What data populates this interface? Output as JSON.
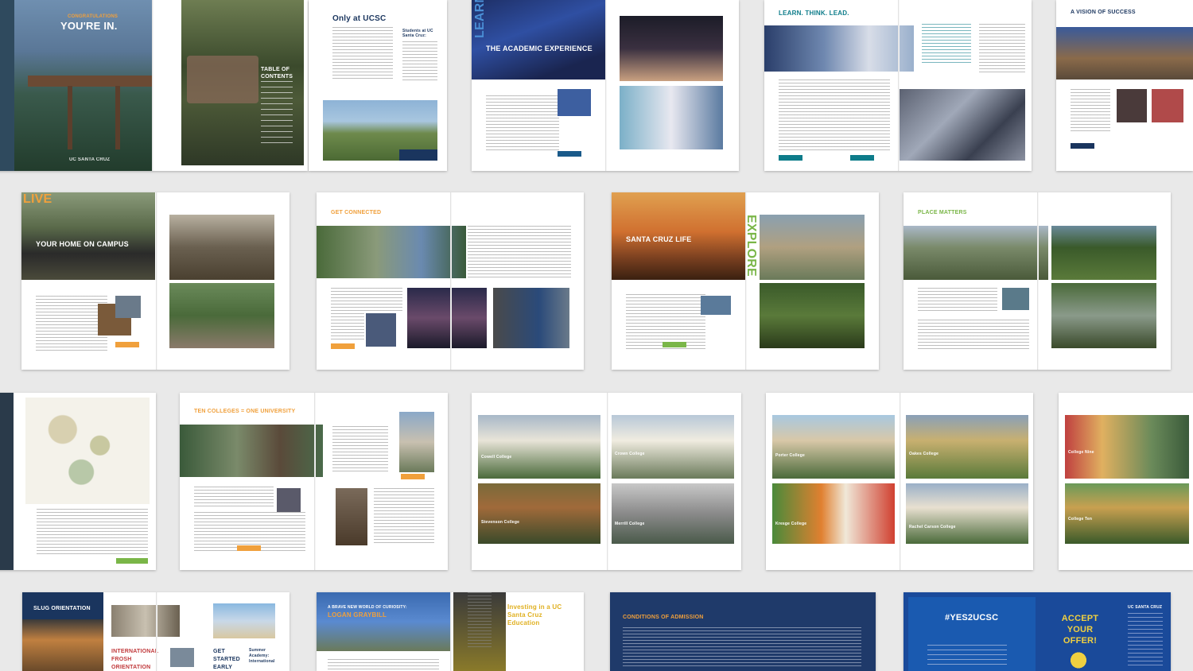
{
  "spreads": {
    "youre_in": {
      "kicker": "CONGRATULATIONS",
      "title": "YOU'RE IN.",
      "logo": "UC SANTA CRUZ",
      "toc_title": "TABLE OF CONTENTS"
    },
    "only_ucsc": {
      "title": "Only at UCSC",
      "sidebar_title": "Students at UC Santa Cruz:"
    },
    "academic": {
      "vertical": "LEARN",
      "title": "THE ACADEMIC EXPERIENCE"
    },
    "learn_think": {
      "title": "LEARN. THINK. LEAD."
    },
    "vision": {
      "title": "A VISION OF SUCCESS"
    },
    "home": {
      "vertical": "LIVE",
      "title": "YOUR HOME ON CAMPUS"
    },
    "connected": {
      "title": "GET CONNECTED"
    },
    "sc_life": {
      "vertical": "EXPLORE",
      "title": "SANTA CRUZ LIFE"
    },
    "place": {
      "title": "PLACE MATTERS"
    },
    "ten_colleges": {
      "title": "TEN COLLEGES = ONE UNIVERSITY"
    },
    "colleges": {
      "cowell": "Cowell College",
      "crown": "Crown College",
      "stevenson": "Stevenson College",
      "merrill": "Merrill College",
      "porter": "Porter College",
      "oakes": "Oakes College",
      "kresge": "Kresge College",
      "rcc": "Rachel Carson College",
      "nine": "College Nine",
      "ten": "College Ten"
    },
    "slug": {
      "title": "SLUG ORIENTATION",
      "intl": "INTERNATIONAL FROSH ORIENTATION",
      "started": "GET STARTED EARLY",
      "summer": "Summer Academy: International"
    },
    "curiosity": {
      "kicker": "A BRAVE NEW WORLD OF CURIOSITY:",
      "name": "LOGAN GRAYBILL",
      "invest": "Investing in a UC Santa Cruz Education"
    },
    "conditions": {
      "title": "CONDITIONS OF ADMISSION"
    },
    "accept": {
      "hashtag": "#YES2UCSC",
      "title": "ACCEPT YOUR OFFER!",
      "logo": "UC SANTA CRUZ"
    }
  },
  "colors": {
    "background": "#e9e9e9",
    "gold": "#f0a03c",
    "teal": "#0d7c8a",
    "navy": "#1a355e",
    "green": "#7ab648"
  }
}
